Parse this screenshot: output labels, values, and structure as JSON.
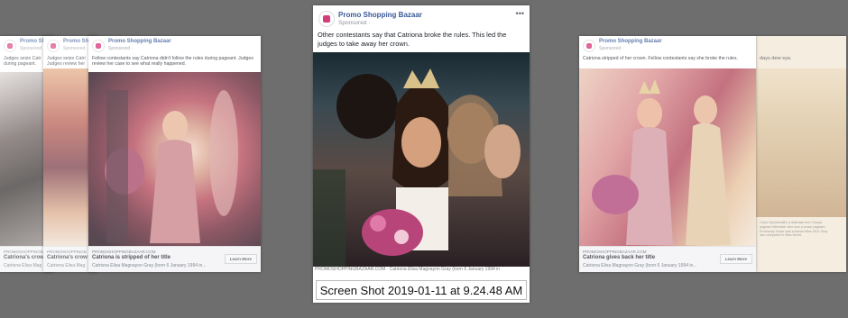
{
  "card_far_left": {
    "page_name": "Promo Sho",
    "sponsored": "Sponsored",
    "body": "Judges seize Catr during pageant.",
    "domain": "PROMOSHOPPINGB",
    "headline": "Catriona's crow",
    "desc": "Catriona Elisa Mag"
  },
  "card_left_mid": {
    "page_name": "Promo Sho",
    "sponsored": "Sponsored",
    "body": "Judges seize Catri Judges review her",
    "domain": "PROMOSHOPPINGB",
    "headline": "Catriona's crow",
    "desc": "Catriona Elisa Mag"
  },
  "card_left": {
    "page_name": "Promo Shopping Bazaar",
    "sponsored": "Sponsored · ",
    "body": "Fellow contestants say Catriona didn't follow the rules during pageant. Judges review her case to see what really happened.",
    "domain": "PROMOSHOPPINGBAZAAR.COM",
    "headline": "Catriona is stripped of her title",
    "desc": "Catriona Elisa Magnayon Gray (born 6 January 1994 in...",
    "cta": "Learn More"
  },
  "card_main": {
    "page_name": "Promo Shopping Bazaar",
    "sponsored": "Sponsored · ",
    "body": "Other contestants say that Catriona broke the rules. This led the judges to take away her crown.",
    "under": "PROMOSHOPPINGBAZAAR.COM · Catriona Elisa Magnayon Gray (born 6 January 1994 in"
  },
  "card_right": {
    "page_name": "Promo Shopping Bazaar",
    "sponsored": "Sponsored · ",
    "body": "Catriona stripped of her crown. Fellow contestants say she broke the rules.",
    "domain": "PROMOSHOPPINGBAZAAR.COM",
    "headline": "Catriona gives back her title",
    "desc": "Catriona Elisa Magnayon Gray (born 6 January 1994 in...",
    "cta": "Learn More",
    "side_text": "days dew sya.",
    "side_small": "Catriu Sposterstill's a dustralan born Soupa pageant titleholder who won a crown pageant. Previously Grace was crowned Miss ISUL Gray also competed in Miss World."
  },
  "tooltip": "Screen Shot 2019-01-11 at 9.24.48 AM",
  "colors": {
    "background": "#6e6e6e",
    "link": "#385898",
    "accent": "#d63c7c"
  }
}
